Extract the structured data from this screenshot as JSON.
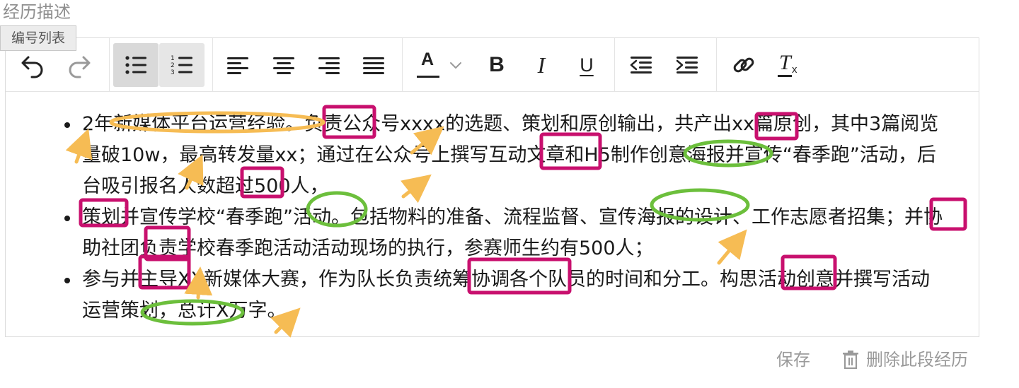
{
  "section": {
    "title": "经历描述"
  },
  "tooltip": {
    "text": "编号列表"
  },
  "toolbar": {
    "undo_icon": "undo-icon",
    "redo_icon": "redo-icon",
    "bulleted_list_icon": "bulleted-list-icon",
    "numbered_list_icon": "numbered-list-icon",
    "align_left_icon": "align-left-icon",
    "align_center_icon": "align-center-icon",
    "align_right_icon": "align-right-icon",
    "align_justify_icon": "align-justify-icon",
    "font_color_glyph": "A",
    "bold_glyph": "B",
    "italic_glyph": "I",
    "underline_glyph": "U",
    "outdent_icon": "outdent-icon",
    "indent_icon": "indent-icon",
    "link_icon": "link-icon",
    "clear_format_glyph": "T",
    "clear_format_sub": "x",
    "active_button": "bulleted-list",
    "active_color": "#d9d9d9"
  },
  "content": {
    "items": [
      "2年新媒体平台运营经验。负责公众号xxxx的选题、策划和原创输出，共产出xx篇原创，其中3篇阅览量破10w，最高转发量xx；通过在公众号上撰写互动文章和H5制作创意海报并宣传“春季跑”活动，后台吸引报名人数超过500人，",
      "策划并宣传学校“春季跑”活动。包括物料的准备、流程监督、宣传海报的设计、工作志愿者招集；并协助社团负责学校春季跑活动活动现场的执行，参赛师生约有500人；",
      "参与并主导XX新媒体大赛，作为队长负责统筹协调各个队员的时间和分工。构思活动创意并撰写活动运营策划，总计X万字。"
    ]
  },
  "annotation_colors": {
    "box": "#c8106e",
    "ellipse_green": "#6cbf3c",
    "ellipse_yellow": "#f6bc54",
    "arrow": "#f6bc54"
  },
  "footer": {
    "save_label": "保存",
    "delete_label": "删除此段经历",
    "delete_icon": "trash-icon"
  }
}
